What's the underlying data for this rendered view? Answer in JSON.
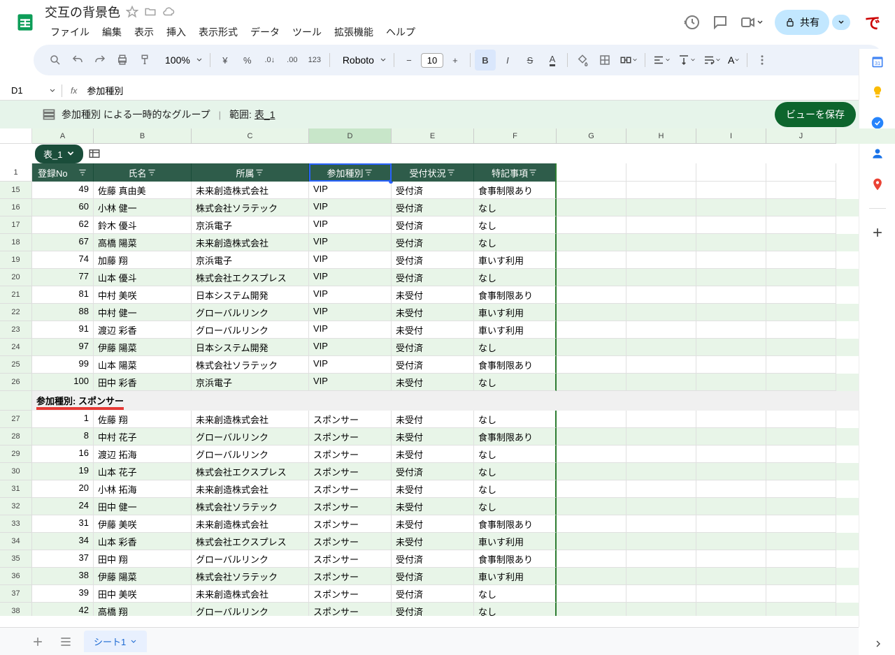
{
  "doc": {
    "title": "交互の背景色"
  },
  "menu": {
    "file": "ファイル",
    "edit": "編集",
    "view": "表示",
    "insert": "挿入",
    "format": "表示形式",
    "data": "データ",
    "tools": "ツール",
    "extensions": "拡張機能",
    "help": "ヘルプ"
  },
  "share": {
    "label": "共有"
  },
  "toolbar": {
    "zoom": "100%",
    "font": "Roboto",
    "size": "10",
    "currency": "¥",
    "percent": "%",
    "dec_dec": ".0",
    "dec_inc": ".00",
    "num123": "123"
  },
  "namebox": {
    "cell": "D1"
  },
  "formula": {
    "value": "参加種別"
  },
  "group_bar": {
    "text": "参加種別 による一時的なグループ",
    "range_label": "範囲:",
    "range": "表_1",
    "save": "ビューを保存"
  },
  "columns": [
    "A",
    "B",
    "C",
    "D",
    "E",
    "F",
    "G",
    "H",
    "I",
    "J"
  ],
  "table_tab": "表_1",
  "headers": {
    "no": "登録No",
    "name": "氏名",
    "org": "所属",
    "type": "参加種別",
    "status": "受付状況",
    "notes": "特記事項"
  },
  "group2": {
    "label": "参加種別: スポンサー"
  },
  "rows1": [
    {
      "rn": "15",
      "no": "49",
      "name": "佐藤 真由美",
      "org": "未来創造株式会社",
      "type": "VIP",
      "status": "受付済",
      "notes": "食事制限あり"
    },
    {
      "rn": "16",
      "no": "60",
      "name": "小林 健一",
      "org": "株式会社ソラテック",
      "type": "VIP",
      "status": "受付済",
      "notes": "なし"
    },
    {
      "rn": "17",
      "no": "62",
      "name": "鈴木 優斗",
      "org": "京浜電子",
      "type": "VIP",
      "status": "受付済",
      "notes": "なし"
    },
    {
      "rn": "18",
      "no": "67",
      "name": "高橋 陽菜",
      "org": "未来創造株式会社",
      "type": "VIP",
      "status": "受付済",
      "notes": "なし"
    },
    {
      "rn": "19",
      "no": "74",
      "name": "加藤 翔",
      "org": "京浜電子",
      "type": "VIP",
      "status": "受付済",
      "notes": "車いす利用"
    },
    {
      "rn": "20",
      "no": "77",
      "name": "山本 優斗",
      "org": "株式会社エクスプレス",
      "type": "VIP",
      "status": "受付済",
      "notes": "なし"
    },
    {
      "rn": "21",
      "no": "81",
      "name": "中村 美咲",
      "org": "日本システム開発",
      "type": "VIP",
      "status": "未受付",
      "notes": "食事制限あり"
    },
    {
      "rn": "22",
      "no": "88",
      "name": "中村 健一",
      "org": "グローバルリンク",
      "type": "VIP",
      "status": "未受付",
      "notes": "車いす利用"
    },
    {
      "rn": "23",
      "no": "91",
      "name": "渡辺 彩香",
      "org": "グローバルリンク",
      "type": "VIP",
      "status": "未受付",
      "notes": "車いす利用"
    },
    {
      "rn": "24",
      "no": "97",
      "name": "伊藤 陽菜",
      "org": "日本システム開発",
      "type": "VIP",
      "status": "受付済",
      "notes": "なし"
    },
    {
      "rn": "25",
      "no": "99",
      "name": "山本 陽菜",
      "org": "株式会社ソラテック",
      "type": "VIP",
      "status": "受付済",
      "notes": "食事制限あり"
    },
    {
      "rn": "26",
      "no": "100",
      "name": "田中 彩香",
      "org": "京浜電子",
      "type": "VIP",
      "status": "未受付",
      "notes": "なし"
    }
  ],
  "rows2": [
    {
      "rn": "27",
      "no": "1",
      "name": "佐藤 翔",
      "org": "未来創造株式会社",
      "type": "スポンサー",
      "status": "未受付",
      "notes": "なし"
    },
    {
      "rn": "28",
      "no": "8",
      "name": "中村 花子",
      "org": "グローバルリンク",
      "type": "スポンサー",
      "status": "未受付",
      "notes": "食事制限あり"
    },
    {
      "rn": "29",
      "no": "16",
      "name": "渡辺 拓海",
      "org": "グローバルリンク",
      "type": "スポンサー",
      "status": "未受付",
      "notes": "なし"
    },
    {
      "rn": "30",
      "no": "19",
      "name": "山本 花子",
      "org": "株式会社エクスプレス",
      "type": "スポンサー",
      "status": "受付済",
      "notes": "なし"
    },
    {
      "rn": "31",
      "no": "20",
      "name": "小林 拓海",
      "org": "未来創造株式会社",
      "type": "スポンサー",
      "status": "未受付",
      "notes": "なし"
    },
    {
      "rn": "32",
      "no": "24",
      "name": "田中 健一",
      "org": "株式会社ソラテック",
      "type": "スポンサー",
      "status": "未受付",
      "notes": "なし"
    },
    {
      "rn": "33",
      "no": "31",
      "name": "伊藤 美咲",
      "org": "未来創造株式会社",
      "type": "スポンサー",
      "status": "未受付",
      "notes": "食事制限あり"
    },
    {
      "rn": "34",
      "no": "34",
      "name": "山本 彩香",
      "org": "株式会社エクスプレス",
      "type": "スポンサー",
      "status": "未受付",
      "notes": "車いす利用"
    },
    {
      "rn": "35",
      "no": "37",
      "name": "田中 翔",
      "org": "グローバルリンク",
      "type": "スポンサー",
      "status": "受付済",
      "notes": "食事制限あり"
    },
    {
      "rn": "36",
      "no": "38",
      "name": "伊藤 陽菜",
      "org": "株式会社ソラテック",
      "type": "スポンサー",
      "status": "受付済",
      "notes": "車いす利用"
    },
    {
      "rn": "37",
      "no": "39",
      "name": "田中 美咲",
      "org": "未来創造株式会社",
      "type": "スポンサー",
      "status": "受付済",
      "notes": "なし"
    },
    {
      "rn": "38",
      "no": "42",
      "name": "高橋 翔",
      "org": "グローバルリンク",
      "type": "スポンサー",
      "status": "受付済",
      "notes": "なし"
    }
  ],
  "bottom": {
    "sheet": "シート1"
  },
  "col_widths": {
    "no": 88,
    "name": 140,
    "org": 168,
    "type": 118,
    "status": 118,
    "notes": 118,
    "extra": 100
  }
}
